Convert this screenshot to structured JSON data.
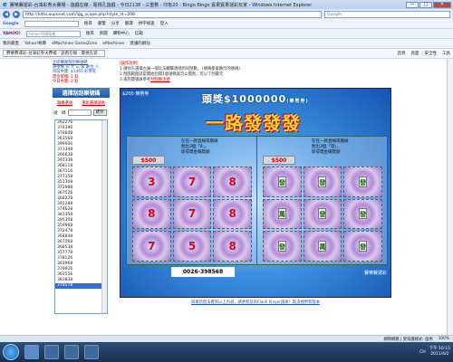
{
  "window": {
    "title": "賽樂賽運彩-台灣彩券大賽場 - 遊戲在線 - 電視孔遊戲 - 今日2138 - 三重數 - 印象20 - Bingo Bingo 賓果賓果運彩玩家 - Windows Internet Explorer",
    "minimize": "─",
    "maximize": "□",
    "close": "✕"
  },
  "address": {
    "url": "http://lotto.auponet.com/igg_scope.php?style_id=208",
    "search_placeholder": "Google"
  },
  "toolbars": {
    "google": {
      "brand": "Google",
      "search_button": "搜尋",
      "items": [
        "書籤",
        "分享",
        "翻譯",
        "拼字檢查",
        "登入"
      ]
    },
    "yahoo": {
      "brand": "YAHOO!",
      "search_placeholder": "Yahoo!奇摩搜尋",
      "search_button": "搜尋",
      "items": [
        "新聞",
        "購物中心",
        "信箱"
      ]
    },
    "favorites": {
      "label": "我的最愛",
      "items": [
        "Yahoo!奇摩",
        "eMachines GameZone",
        "eMachines",
        "建議的網站"
      ]
    },
    "tab": {
      "label": "賽樂賽運彩-台灣彩券大賽場 - 遊戲在線 - 電視孔遊...",
      "menus": [
        "首頁",
        "頁面",
        "安全性",
        "工具"
      ]
    }
  },
  "sidebar": {
    "info_lines": [
      "立即購買刮刮樂號碼",
      "選號樂 玩 大 三 家 數位 人",
      "目前中獎: $1465 彩幣等",
      "獎金累積: 2 點",
      "今日中獎: 2 點"
    ],
    "select_button": "選擇刮刮樂號碼",
    "link_random": "隨機選號",
    "link_clear": "重新選擇號碼",
    "jump_label": "號　碼",
    "jump_button": "跳到",
    "numbers": [
      "362276",
      "374396",
      "378848",
      "361568",
      "399906",
      "373348",
      "366638",
      "397338",
      "368118",
      "367116",
      "377158",
      "351308",
      "372988",
      "367526",
      "368228",
      "391288",
      "374628",
      "381358",
      "395308",
      "359968",
      "372478",
      "368848",
      "367568",
      "368538",
      "357778",
      "378126",
      "361968",
      "379926",
      "363556",
      "383838",
      "378578"
    ],
    "selected_index": 30
  },
  "notes": {
    "heading": "[操作說明]",
    "lines": [
      "1.請你先選擇左邊一個玩法觸擊連碼到同刮數， (號碼都會顯示的號碼)",
      "2.刮開範圍就是開始刮開1個號碼就可以開刮，可以了刮最完",
      "3.查詢獎號請參考"
    ],
    "rules_link": "刮刮樂活規"
  },
  "game": {
    "price": "$200 樂幣券",
    "jackpot": "頭獎$1000000",
    "jackpot_unit": "(樂幣券)",
    "logo": "一路發發發",
    "left": {
      "instruction": [
        "在任一款直線或橫線",
        "刮出3個「8」，",
        "即得獎金欄獎額"
      ],
      "amount": "$500",
      "cells": [
        "3",
        "7",
        "8",
        "8",
        "7",
        "8",
        "7",
        "5",
        "8"
      ]
    },
    "right": {
      "instruction": [
        "在任一款直線或橫線",
        "刮出3個「發」，",
        "即得獎金欄獎額"
      ],
      "amount": "$500",
      "cells": [
        "發",
        "發",
        "發",
        "萬",
        "發",
        "發",
        "發",
        "萬",
        "發"
      ]
    },
    "serial": "0026-398568",
    "brand": "賽樂賽運彩"
  },
  "flash_note": "如果您無法看到以上內容，請更新您的Flash Player版本！點這裡更新版本",
  "status": {
    "zone": "網際網路 | 受保護模式: 啟用",
    "zoom": "100%"
  },
  "taskbar": {
    "time": "下午 10:15",
    "date": "2011/4/2",
    "lang": "CH"
  }
}
